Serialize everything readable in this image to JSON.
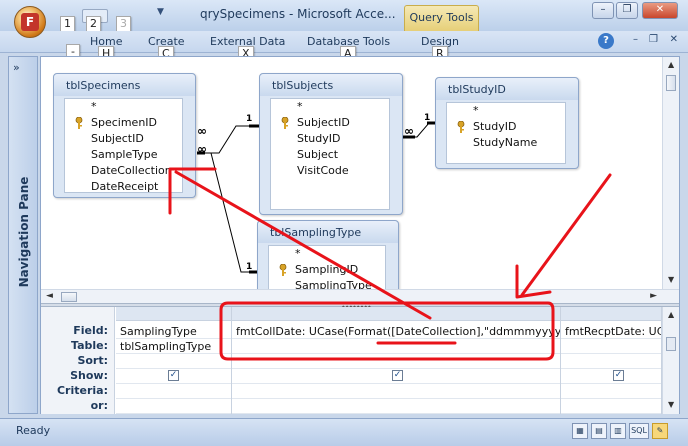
{
  "window": {
    "title": "qrySpecimens - Microsoft Acce...",
    "context_tab": "Query Tools",
    "minimize": "–",
    "restore": "❐",
    "close": "✕"
  },
  "office_button": {
    "icon": "office-logo-icon",
    "glyph": "F"
  },
  "keytips": {
    "one": "1",
    "two": "2",
    "three": "3",
    "f": "F",
    "h": "H",
    "c": "C",
    "x": "X",
    "a": "A",
    "r": "R"
  },
  "qat_arrow": "▼",
  "ribbon": {
    "tabs": [
      "Home",
      "Create",
      "External Data",
      "Database Tools",
      "Design"
    ],
    "help": "?",
    "mini_min": "–",
    "mini_restore": "❐",
    "mini_close": "✕"
  },
  "nav_pane": {
    "collapse": "»",
    "label": "Navigation Pane"
  },
  "tables": [
    {
      "name": "tblSpecimens",
      "fields": [
        "*",
        "SpecimenID",
        "SubjectID",
        "SampleType",
        "DateCollection",
        "DateReceipt"
      ],
      "key_field": "SpecimenID"
    },
    {
      "name": "tblSubjects",
      "fields": [
        "*",
        "SubjectID",
        "StudyID",
        "Subject",
        "VisitCode"
      ],
      "key_field": "SubjectID"
    },
    {
      "name": "tblStudyID",
      "fields": [
        "*",
        "StudyID",
        "StudyName"
      ],
      "key_field": "StudyID"
    },
    {
      "name": "tblSamplingType",
      "fields": [
        "*",
        "SamplingID",
        "SamplingType"
      ],
      "key_field": "SamplingID"
    }
  ],
  "relationships": {
    "one": "1",
    "many": "∞"
  },
  "grid": {
    "row_labels": [
      "Field:",
      "Table:",
      "Sort:",
      "Show:",
      "Criteria:",
      "or:"
    ],
    "columns": [
      {
        "field": "SamplingType",
        "table": "tblSamplingType",
        "show": true
      },
      {
        "field": "fmtCollDate: UCase(Format([DateCollection],\"ddmmmyyyy\"))",
        "table": "",
        "show": true
      },
      {
        "field": "fmtRecptDate: UC",
        "table": "",
        "show": true
      }
    ]
  },
  "status": {
    "text": "Ready",
    "views": [
      "grid",
      "pivot",
      "chart",
      "form",
      "sql",
      "design"
    ],
    "sql_label": "SQL"
  },
  "colors": {
    "annotation": "#e8131a",
    "accent": "#1e395b"
  }
}
